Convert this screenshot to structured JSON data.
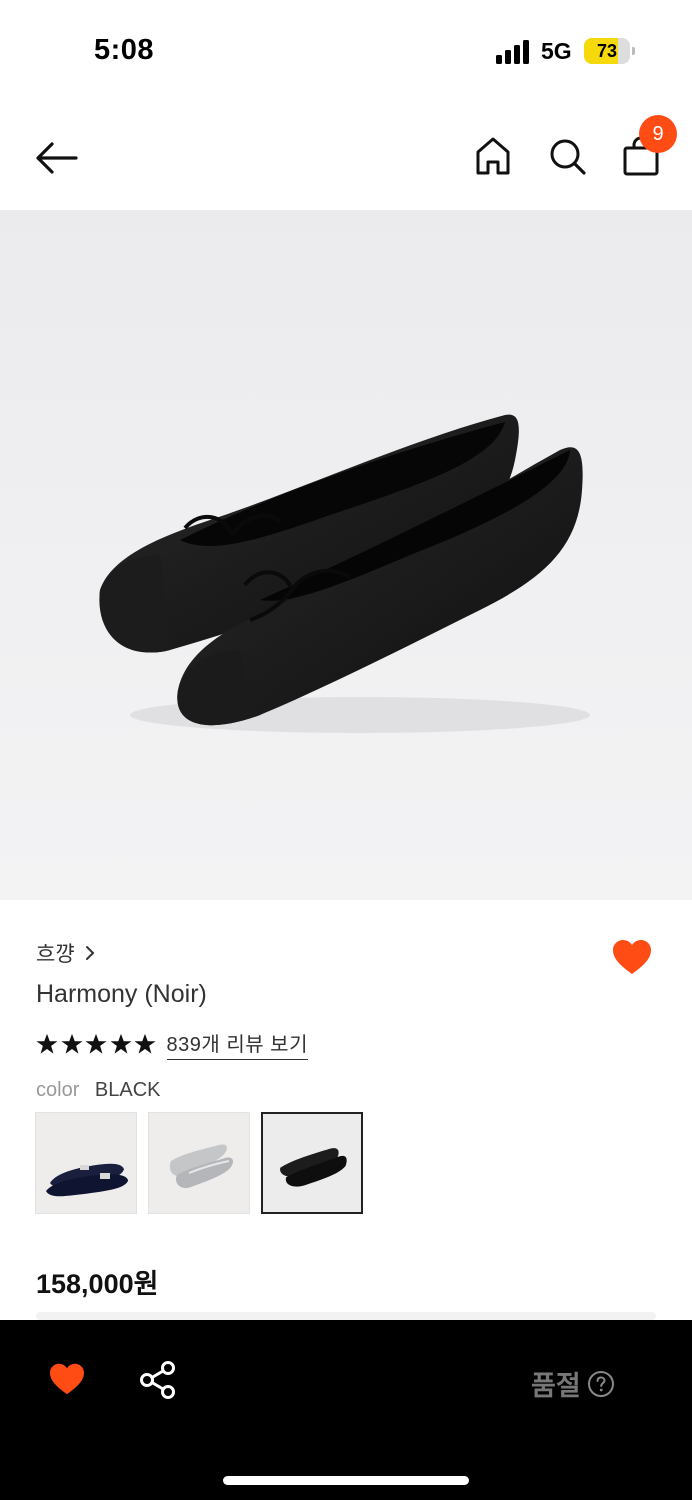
{
  "status_bar": {
    "time": "5:08",
    "network": "5G",
    "battery_percent": "73",
    "battery_level": 0.73
  },
  "nav": {
    "back_icon": "arrow-left-icon",
    "home_icon": "home-icon",
    "search_icon": "search-icon",
    "cart_icon": "shopping-bag-icon",
    "cart_count": "9"
  },
  "product": {
    "brand": "흐꺙",
    "title": "Harmony (Noir)",
    "rating": 5,
    "review_link": "839개 리뷰 보기",
    "color_label": "color",
    "color_value": "BLACK",
    "swatches": [
      {
        "color": "navy patent",
        "selected": false
      },
      {
        "color": "silver",
        "selected": false
      },
      {
        "color": "black",
        "selected": true
      }
    ],
    "price": "158,000원",
    "wishlisted": true
  },
  "bottom_bar": {
    "heart_icon": "heart-icon",
    "share_icon": "share-icon",
    "soldout_label": "품절",
    "help_icon": "question-circle-icon"
  },
  "colors": {
    "accent": "#ff4b14",
    "bottom_bar": "#000000",
    "battery": "#f5d90a"
  }
}
